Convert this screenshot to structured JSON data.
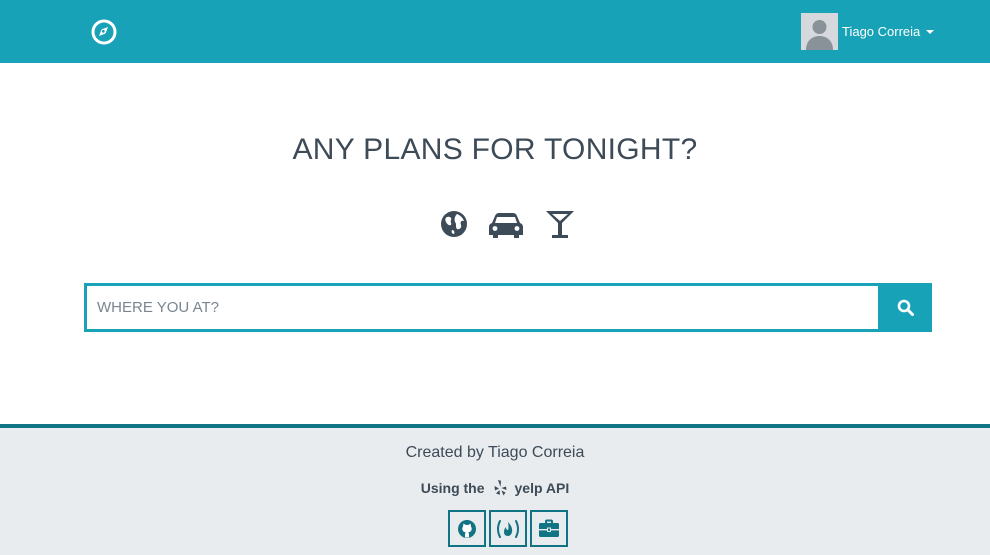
{
  "header": {
    "brand_icon": "compass-icon",
    "user": {
      "name": "Tiago Correia",
      "avatar_icon": "avatar-placeholder-icon",
      "menu_icon": "caret-down-icon"
    }
  },
  "hero": {
    "title": "ANY PLANS FOR TONIGHT?",
    "icons": [
      "globe-icon",
      "car-icon",
      "cocktail-icon"
    ]
  },
  "search": {
    "value": "",
    "placeholder": "WHERE YOU AT?",
    "button_icon": "search-icon"
  },
  "footer": {
    "credit": "Created by Tiago Correia",
    "api_prefix": "Using the",
    "api_name": "yelp API",
    "api_icon": "yelp-icon",
    "links": [
      {
        "icon": "github-icon"
      },
      {
        "icon": "freecodecamp-icon"
      },
      {
        "icon": "briefcase-icon"
      }
    ]
  },
  "colors": {
    "primary": "#17a2b8",
    "primary_dark": "#117484",
    "text": "#3d4a57",
    "footer_bg": "#e9ecef"
  }
}
